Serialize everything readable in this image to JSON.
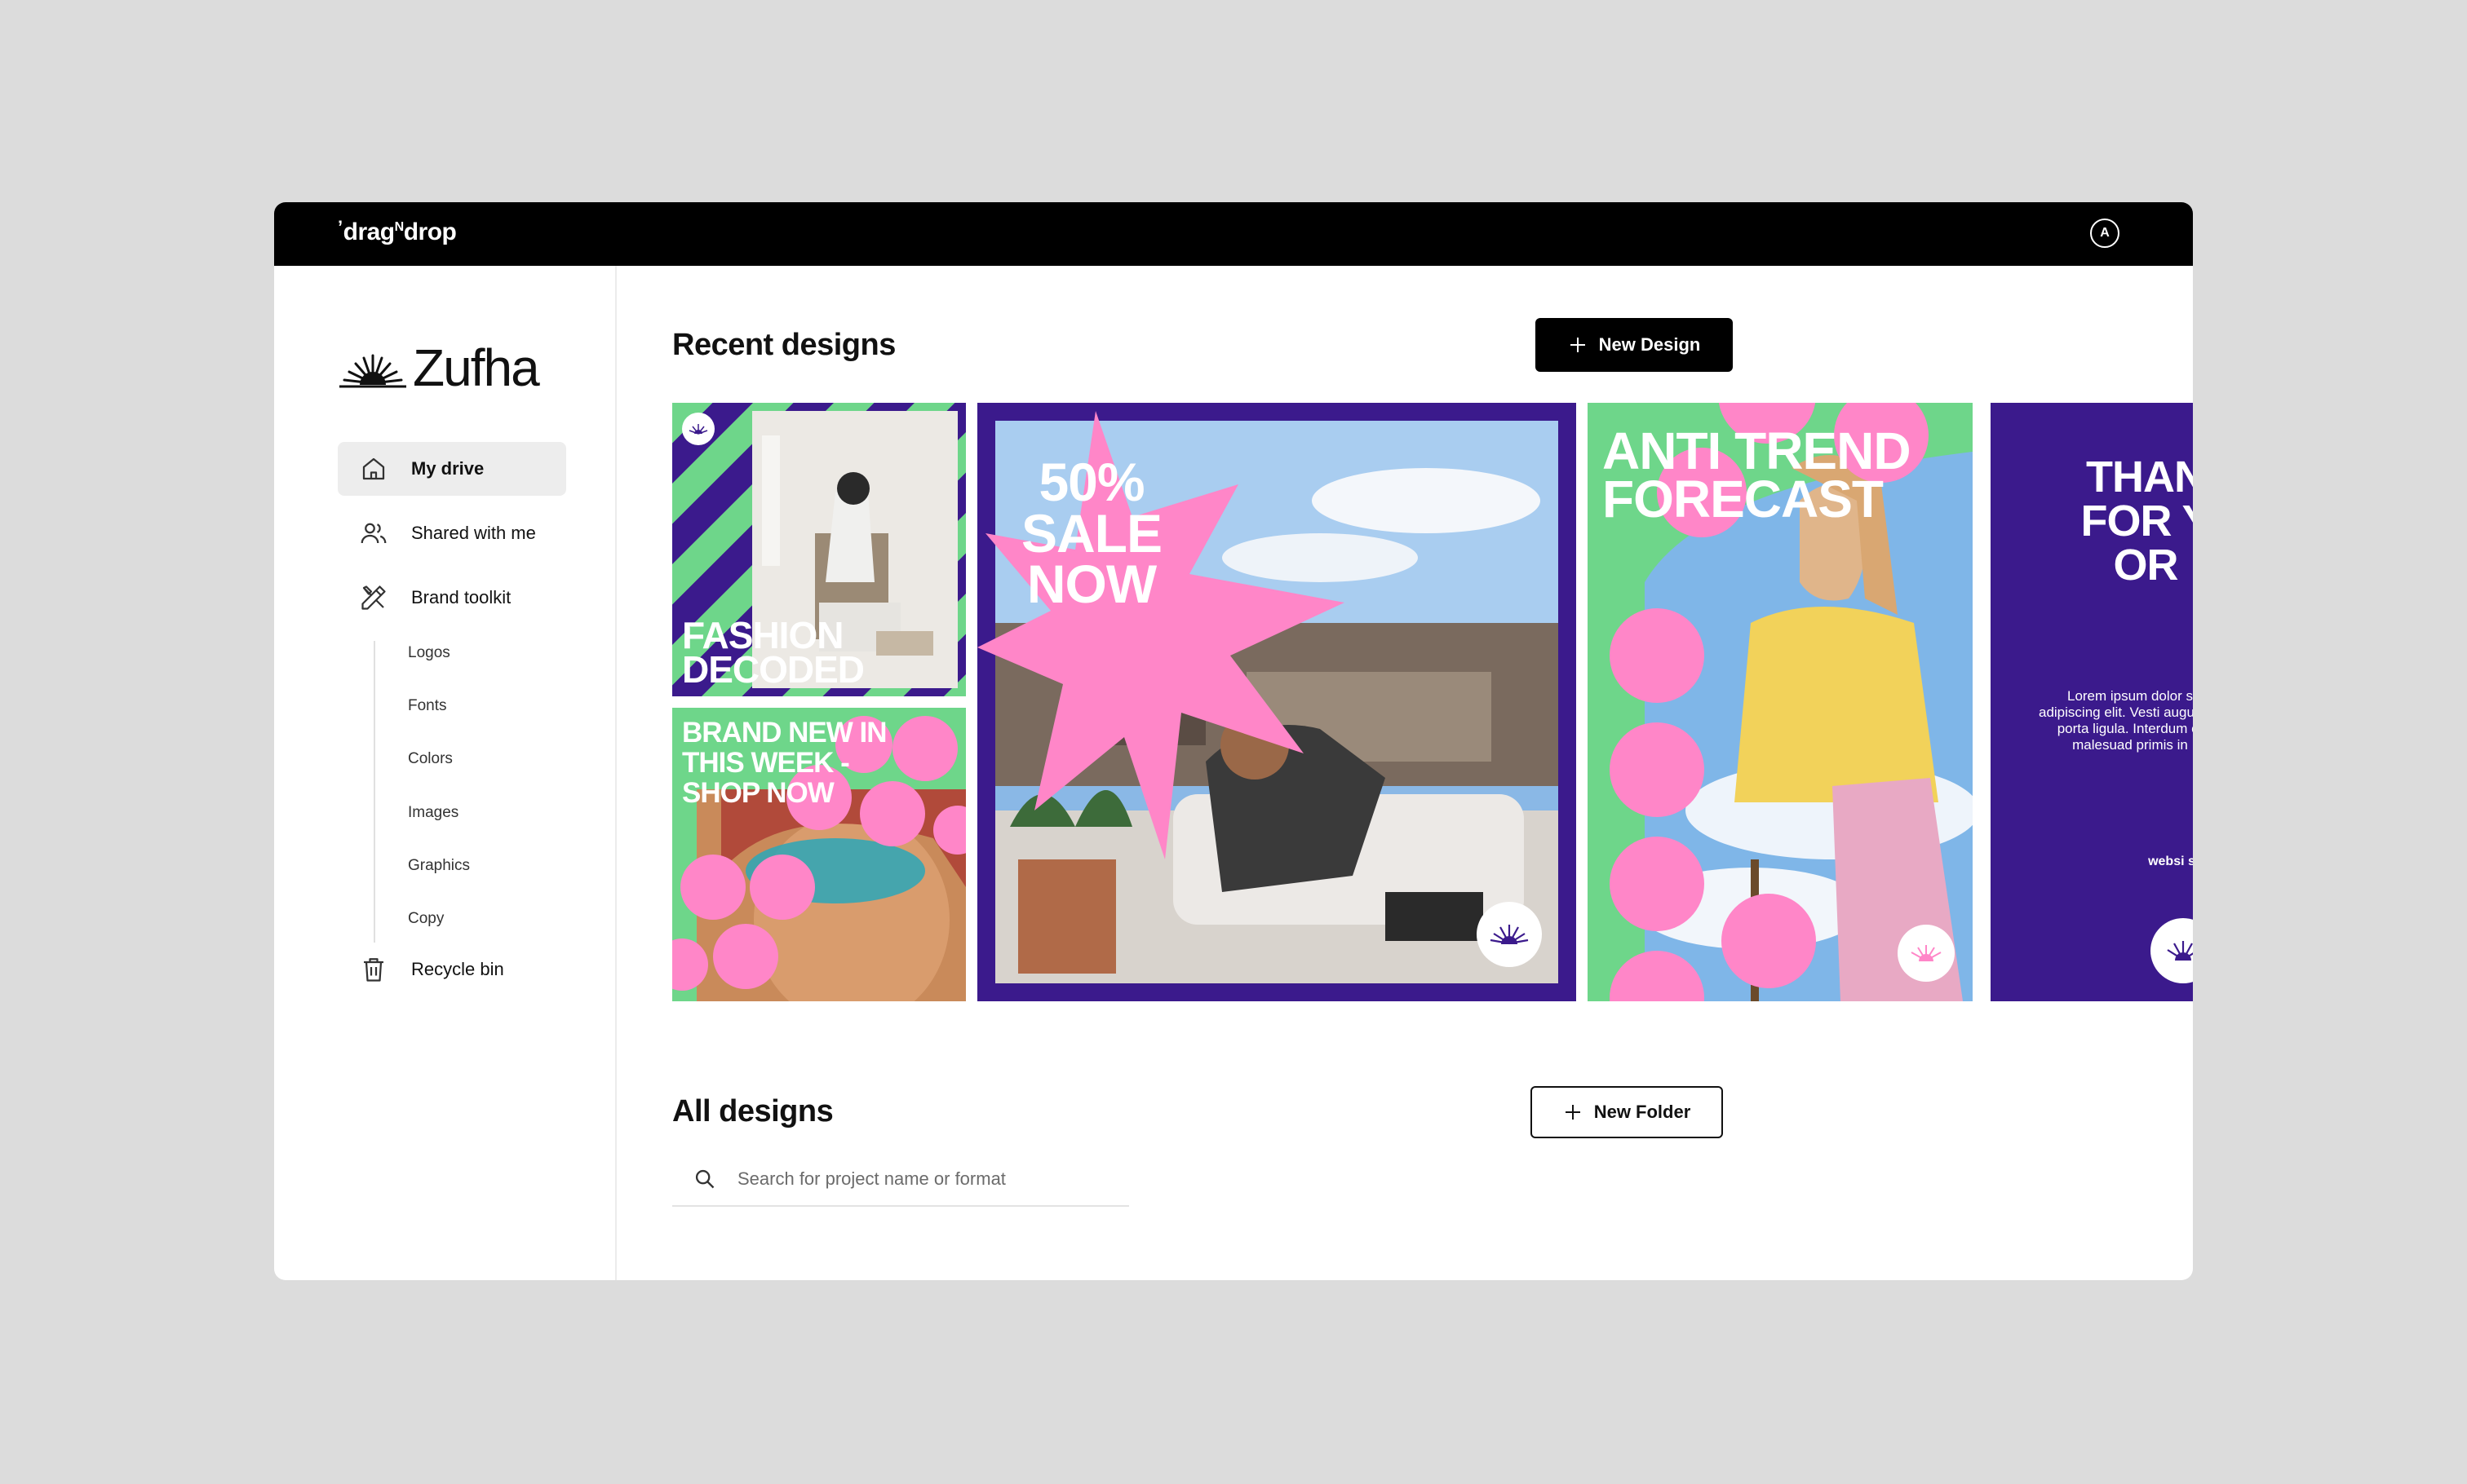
{
  "app": {
    "brand": "drag",
    "brand_sup": "N",
    "brand_end": "drop",
    "avatar_initial": "A"
  },
  "workspace": {
    "name": "Zufha"
  },
  "sidebar": {
    "items": [
      {
        "label": "My drive",
        "icon": "home-icon",
        "active": true
      },
      {
        "label": "Shared with me",
        "icon": "users-icon"
      },
      {
        "label": "Brand toolkit",
        "icon": "brand-toolkit-icon"
      }
    ],
    "toolkit": [
      "Logos",
      "Fonts",
      "Colors",
      "Images",
      "Graphics",
      "Copy"
    ],
    "recycle": {
      "label": "Recycle bin",
      "icon": "trash-icon"
    }
  },
  "recent": {
    "title": "Recent designs",
    "new_button": "New Design",
    "cards": [
      {
        "text": "FASHION DECODED"
      },
      {
        "text": "BRAND NEW IN THIS WEEK - SHOP NOW"
      },
      {
        "text": "50% SALE NOW"
      },
      {
        "text": "ANTI TREND FORECAST"
      },
      {
        "text": "THAN FOR Y OR",
        "body": "Lorem ipsum dolor s adipiscing elit. Vesti augue, at porta ligula. Interdum et malesuad primis in",
        "footer": "websi socia"
      }
    ]
  },
  "all": {
    "title": "All designs",
    "new_folder_button": "New Folder",
    "search_placeholder": "Search for project name or format"
  },
  "colors": {
    "green": "#6ed68a",
    "purple": "#3b1a8c",
    "pink": "#ff86c8",
    "dark": "#000000"
  }
}
